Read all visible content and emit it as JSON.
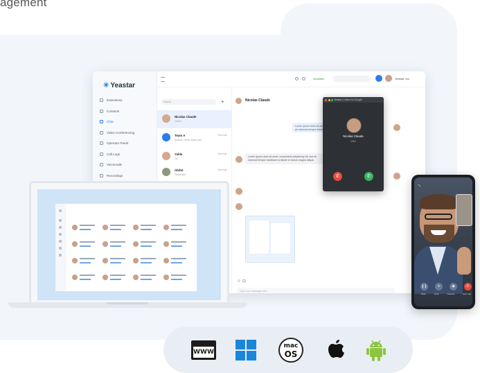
{
  "heading": "agement",
  "desktop": {
    "logo": "Yeastar",
    "nav": [
      "Extensions",
      "Contacts",
      "Chat",
      "Video Conferencing",
      "Operator Panel",
      "Call Logs",
      "Voicemails",
      "Recordings"
    ],
    "search_placeholder": "Search",
    "conversations": [
      {
        "name": "Nicolas Claude",
        "sub": "Online",
        "time": ""
      },
      {
        "name": "Team A",
        "sub": "Andrew: Great, thank you!",
        "time": "Yesterday"
      },
      {
        "name": "Yalile",
        "sub": "Ok",
        "time": "Yesterday"
      },
      {
        "name": "Abdul",
        "sub": "Thank you",
        "time": "Yesterday"
      }
    ],
    "chat_title": "Nicolas Claude",
    "status": "Available",
    "user": "Yeastar, Inc.",
    "bubble_right": "Lorem ipsum dolor sit amet, sed do eiusmod tempor incididunt",
    "bubble_left": "Lorem ipsum dolor sit amet, consectetur adipiscing elit, sed do eiusmod tempor incididunt ut labore et dolore magna aliqua.",
    "input_placeholder": "Type your message here"
  },
  "call": {
    "title": "Yeastar | Linkus for Google",
    "name": "Nicolas Claude",
    "number": "1001"
  },
  "phone": {
    "controls": [
      "Mute",
      "Hold",
      "Camera",
      "End Call"
    ]
  },
  "platforms": [
    "web-browser-icon",
    "windows-icon",
    "macos-icon",
    "apple-icon",
    "android-icon"
  ],
  "macos": {
    "line1": "mac",
    "line2": "OS"
  },
  "www_label": "WWW",
  "colors": {
    "accent": "#2b7de9",
    "windows": "#1a86d9",
    "android": "#8cc63f",
    "call_end": "#e84a3c",
    "call_answer": "#36b25d"
  }
}
